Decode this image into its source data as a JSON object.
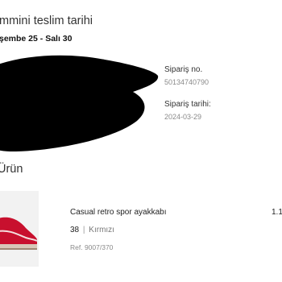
{
  "delivery": {
    "label": "mmini teslim tarihi",
    "dates": "şembe 25 - Salı 30"
  },
  "order": {
    "number_label": "Sipariş no.",
    "number_value": "50134740790",
    "date_label": "Sipariş tarihi:",
    "date_value": "2024-03-29"
  },
  "items_section": {
    "title": "Ürün"
  },
  "product": {
    "name": "Casual retro spor ayakkabı",
    "size": "38",
    "separator": "|",
    "color": "Kırmızı",
    "ref": "Ref. 9007/370",
    "price": "1.1",
    "image_icon": "red-sneaker-image",
    "accent_color": "#c8102e"
  }
}
